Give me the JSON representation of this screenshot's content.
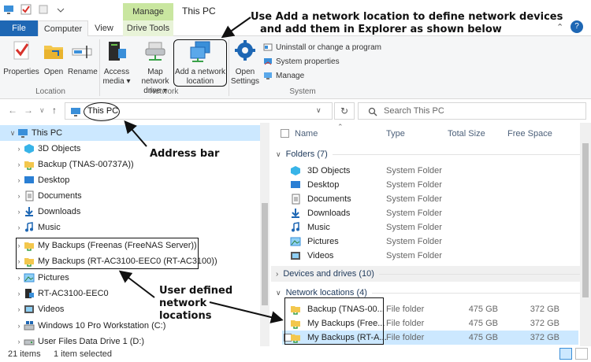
{
  "window": {
    "title": "This PC",
    "context_tab": "Manage",
    "controls": [
      "—",
      "☐",
      "✕"
    ],
    "help": "?"
  },
  "ribbon_tabs": [
    "File",
    "Computer",
    "View",
    "Drive Tools"
  ],
  "ribbon": {
    "location": {
      "label": "Location",
      "buttons": [
        "Properties",
        "Open",
        "Rename"
      ]
    },
    "network": {
      "label": "Network",
      "access_media": [
        "Access",
        "media ▾"
      ],
      "map_drive": [
        "Map network",
        "drive ▾"
      ],
      "add_location": [
        "Add a network",
        "location"
      ]
    },
    "system": {
      "label": "System",
      "open_settings": [
        "Open",
        "Settings"
      ],
      "uninstall": "Uninstall or change a program",
      "sys_props": "System properties",
      "manage": "Manage"
    }
  },
  "address": {
    "path": "This PC",
    "search_placeholder": "Search This PC"
  },
  "nav_tree": [
    "This PC",
    "3D Objects",
    "Backup (TNAS-00737A))",
    "Desktop",
    "Documents",
    "Downloads",
    "Music",
    "My Backups (Freenas (FreeNAS Server))",
    "My Backups (RT-AC3100-EEC0 (RT-AC3100))",
    "Pictures",
    "RT-AC3100-EEC0",
    "Videos",
    "Windows 10 Pro Workstation (C:)",
    "User Files Data Drive 1 (D:)"
  ],
  "columns": [
    "Name",
    "Type",
    "Total Size",
    "Free Space"
  ],
  "groups": {
    "folders": "Folders (7)",
    "drives": "Devices and drives (10)",
    "network": "Network locations (4)"
  },
  "folders": [
    {
      "name": "3D Objects",
      "type": "System Folder"
    },
    {
      "name": "Desktop",
      "type": "System Folder"
    },
    {
      "name": "Documents",
      "type": "System Folder"
    },
    {
      "name": "Downloads",
      "type": "System Folder"
    },
    {
      "name": "Music",
      "type": "System Folder"
    },
    {
      "name": "Pictures",
      "type": "System Folder"
    },
    {
      "name": "Videos",
      "type": "System Folder"
    }
  ],
  "network_locations": [
    {
      "name": "Backup (TNAS-00...",
      "type": "File folder",
      "total": "475 GB",
      "free": "372 GB"
    },
    {
      "name": "My Backups (Free...",
      "type": "File folder",
      "total": "475 GB",
      "free": "372 GB"
    },
    {
      "name": "My Backups (RT-A...",
      "type": "File folder",
      "total": "475 GB",
      "free": "372 GB"
    }
  ],
  "status": {
    "items": "21 items",
    "selected": "1 item selected"
  },
  "annotations": {
    "top": [
      "Use Add a network location to define network devices",
      "and add them in Explorer as shown below"
    ],
    "address_bar": "Address bar",
    "user_defined": [
      "User defined",
      "network",
      "locations"
    ]
  }
}
